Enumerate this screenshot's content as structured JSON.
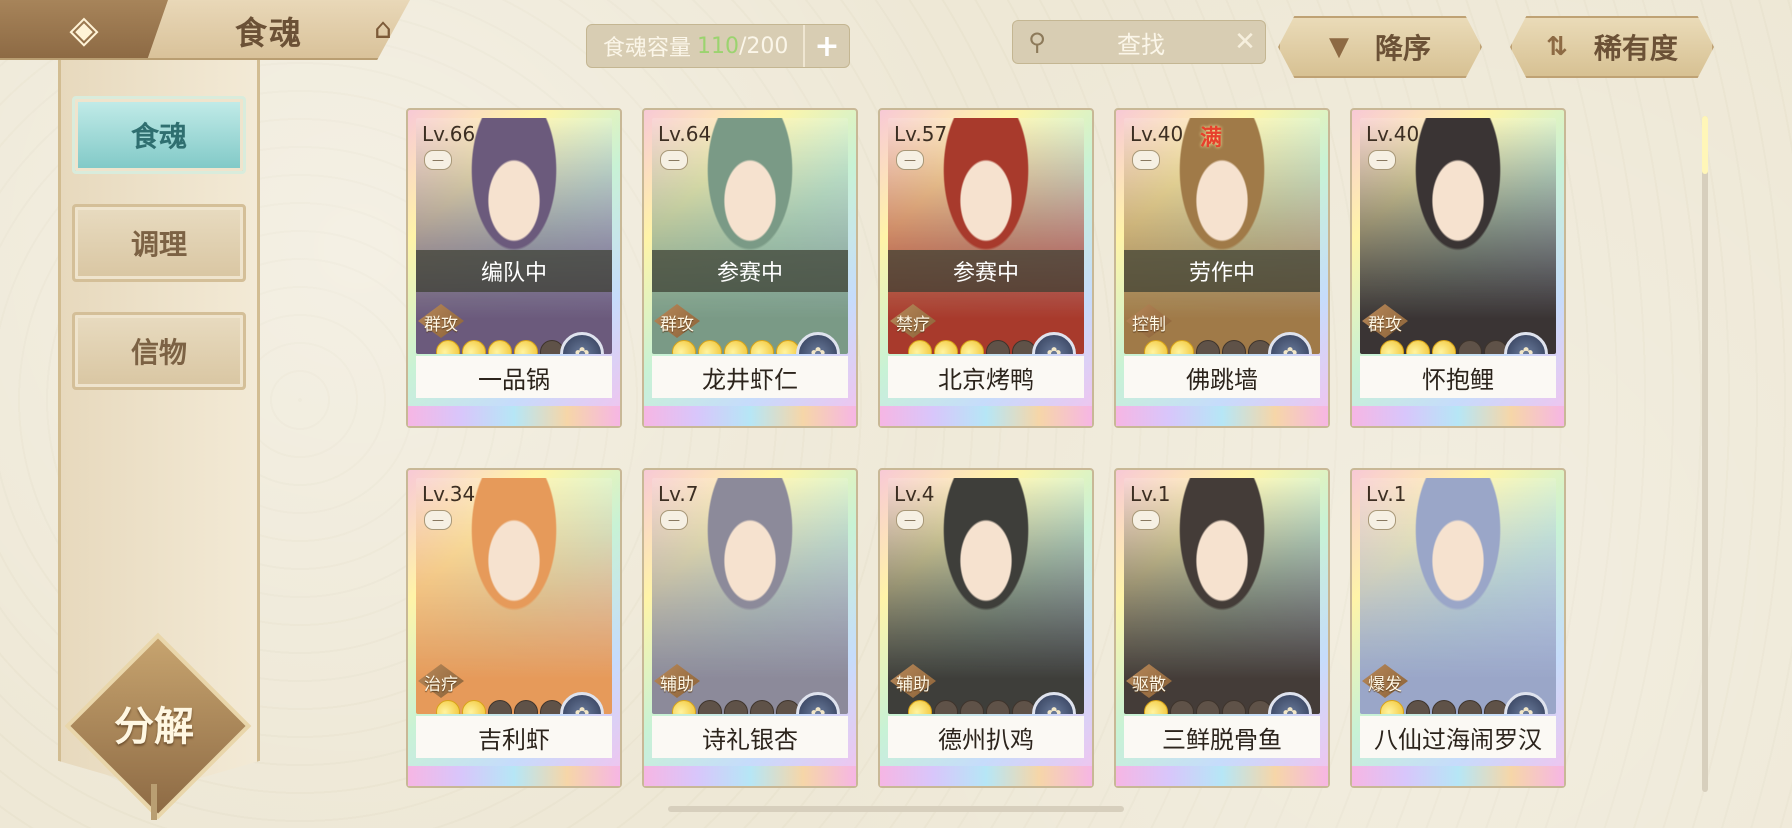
{
  "header": {
    "title": "食魂",
    "back_icon": "back-arrow-icon",
    "home_icon": "pavilion-icon",
    "capacity": {
      "label": "食魂容量",
      "current": "110",
      "total": "/200",
      "add_symbol": "+"
    },
    "search": {
      "placeholder": "查找",
      "clear_symbol": "✕"
    },
    "sort_button": {
      "label": "降序",
      "icon": "triangle-down-icon"
    },
    "rarity_button": {
      "label": "稀有度",
      "icon": "swap-icon"
    }
  },
  "sidebar": {
    "tabs": [
      {
        "label": "食魂",
        "active": true
      },
      {
        "label": "调理",
        "active": false
      },
      {
        "label": "信物",
        "active": false
      }
    ],
    "decompose_label": "分解"
  },
  "cards": [
    {
      "level": "Lv.66",
      "name": "一品锅",
      "status": "编队中",
      "role": "群攻",
      "stars": 4,
      "full": "",
      "hue": "#6b5a7c"
    },
    {
      "level": "Lv.64",
      "name": "龙井虾仁",
      "status": "参赛中",
      "role": "群攻",
      "stars": 5,
      "full": "",
      "hue": "#7a9a86"
    },
    {
      "level": "Lv.57",
      "name": "北京烤鸭",
      "status": "参赛中",
      "role": "禁疗",
      "stars": 3,
      "full": "",
      "hue": "#a83a2c"
    },
    {
      "level": "Lv.40",
      "name": "佛跳墙",
      "status": "劳作中",
      "role": "控制",
      "stars": 2,
      "full": "满",
      "hue": "#a07a48"
    },
    {
      "level": "Lv.40",
      "name": "怀抱鲤",
      "status": "",
      "role": "群攻",
      "stars": 3,
      "full": "",
      "hue": "#3a3434"
    },
    {
      "level": "Lv.34",
      "name": "吉利虾",
      "status": "",
      "role": "治疗",
      "stars": 2,
      "full": "",
      "hue": "#e69a5a"
    },
    {
      "level": "Lv.7",
      "name": "诗礼银杏",
      "status": "",
      "role": "辅助",
      "stars": 1,
      "full": "",
      "hue": "#8c8a9a"
    },
    {
      "level": "Lv.4",
      "name": "德州扒鸡",
      "status": "",
      "role": "辅助",
      "stars": 1,
      "full": "",
      "hue": "#3e3e3a"
    },
    {
      "level": "Lv.1",
      "name": "三鲜脱骨鱼",
      "status": "",
      "role": "驱散",
      "stars": 1,
      "full": "",
      "hue": "#443c38"
    },
    {
      "level": "Lv.1",
      "name": "八仙过海闹罗汉",
      "status": "",
      "role": "爆发",
      "stars": 1,
      "full": "",
      "hue": "#9aa6c8"
    }
  ]
}
